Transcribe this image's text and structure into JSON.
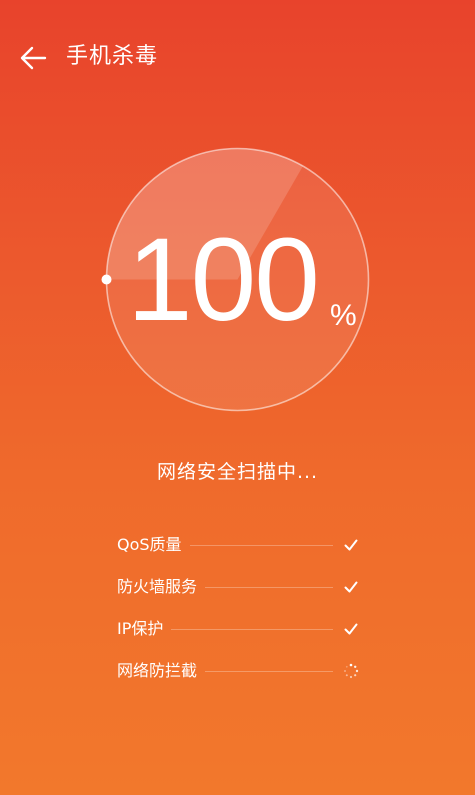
{
  "header": {
    "title": "手机杀毒"
  },
  "scan": {
    "progress": 100,
    "progress_text": "100",
    "unit": "%",
    "status": "网络安全扫描中..."
  },
  "checks": [
    {
      "label": "QoS质量",
      "state": "done"
    },
    {
      "label": "防火墙服务",
      "state": "done"
    },
    {
      "label": "IP保护",
      "state": "done"
    },
    {
      "label": "网络防拦截",
      "state": "loading"
    }
  ],
  "colors": {
    "background_top": "#e8432c",
    "background_bottom": "#f2782c",
    "foreground": "#ffffff"
  },
  "icons": {
    "back": "arrow-left-icon",
    "done": "check-icon",
    "loading": "spinner-icon"
  }
}
